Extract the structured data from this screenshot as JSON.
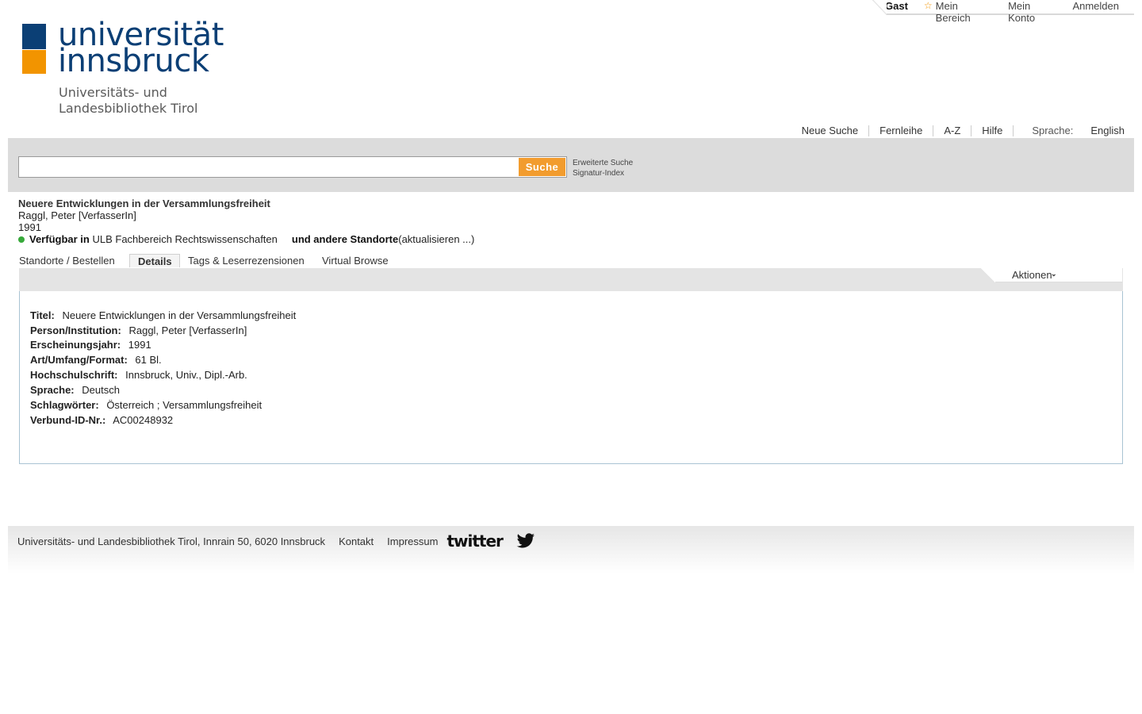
{
  "userbar": {
    "guest": "Gast",
    "mein_bereich": "Mein Bereich",
    "mein_konto": "Mein Konto",
    "anmelden": "Anmelden"
  },
  "logo": {
    "line1": "universität",
    "line2": "innsbruck",
    "sub1": "Universitäts- und",
    "sub2": "Landesbibliothek Tirol"
  },
  "subnav": {
    "neue_suche": "Neue Suche",
    "fernleihe": "Fernleihe",
    "az": "A-Z",
    "hilfe": "Hilfe",
    "sprache_label": "Sprache:",
    "sprache_value": "English"
  },
  "search": {
    "value": "",
    "button": "Suche",
    "advanced": "Erweiterte Suche",
    "signatur": "Signatur-Index"
  },
  "record": {
    "title": "Neuere Entwicklungen in der Versammlungsfreiheit",
    "author": "Raggl, Peter [VerfasserIn]",
    "year": "1991",
    "avail_label": "Verfügbar in",
    "avail_location": "ULB Fachbereich Rechtswissenschaften",
    "avail_other": "und andere Standorte",
    "avail_refresh": "(aktualisieren ...)"
  },
  "tabs": [
    "Standorte / Bestellen",
    "Details",
    "Tags & Leserrezensionen",
    "Virtual Browse"
  ],
  "actions": {
    "label": "Aktionen"
  },
  "details": [
    {
      "label": "Titel:",
      "value": "Neuere Entwicklungen in der Versammlungsfreiheit"
    },
    {
      "label": "Person/Institution:",
      "value": "Raggl, Peter [VerfasserIn]"
    },
    {
      "label": "Erscheinungsjahr:",
      "value": "1991"
    },
    {
      "label": "Art/Umfang/Format:",
      "value": "61 Bl."
    },
    {
      "label": "Hochschulschrift:",
      "value": "Innsbruck, Univ., Dipl.-Arb."
    },
    {
      "label": "Sprache:",
      "value": "Deutsch"
    },
    {
      "label": "Schlagwörter:",
      "value": "Österreich ; Versammlungsfreiheit"
    },
    {
      "label": "Verbund-ID-Nr.:",
      "value": "AC00248932"
    }
  ],
  "footer": {
    "address": "Universitäts- und Landesbibliothek Tirol, Innrain 50, 6020 Innsbruck",
    "kontakt": "Kontakt",
    "impressum": "Impressum",
    "twitter": "twitter"
  },
  "colors": {
    "brand_blue": "#0b3f75",
    "brand_orange": "#f29400",
    "available_green": "#37a93a"
  }
}
